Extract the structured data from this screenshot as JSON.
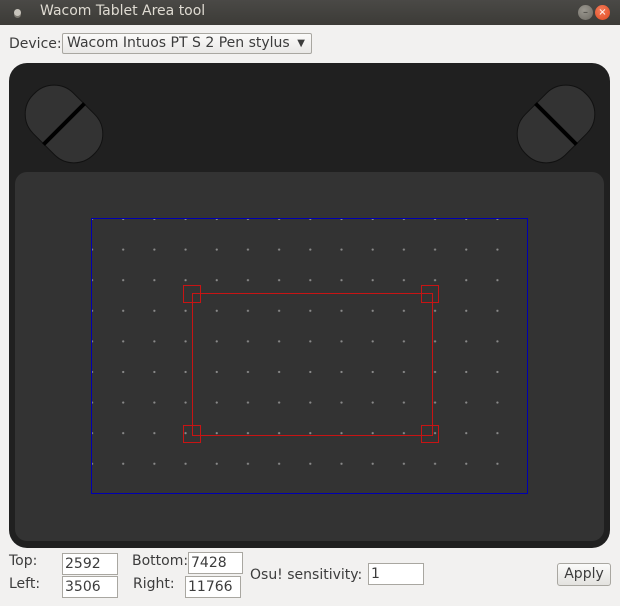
{
  "window": {
    "title": "Wacom Tablet Area tool",
    "minimize_glyph": "–",
    "close_glyph": "×"
  },
  "device": {
    "label": "Device:",
    "selected": "Wacom Intuos PT S 2 Pen stylus",
    "arrow": "▼"
  },
  "fields": {
    "top_label": "Top:",
    "top_value": "2592",
    "bottom_label": "Bottom:",
    "bottom_value": "7428",
    "left_label": "Left:",
    "left_value": "3506",
    "right_label": "Right:",
    "right_value": "11766",
    "sensitivity_label": "Osu! sensitivity:",
    "sensitivity_value": "1"
  },
  "apply_label": "Apply",
  "colors": {
    "tablet_body": "#202020",
    "active_panel": "#333333",
    "full_area_border": "#0000b0",
    "selection_border": "#c81414",
    "titlebar": "#3c3b37",
    "close_button": "#e0491f"
  },
  "icons": {
    "window": "app-dot-icon",
    "minimize": "minimize-icon",
    "close": "close-icon",
    "dropdown": "chevron-down-icon"
  }
}
